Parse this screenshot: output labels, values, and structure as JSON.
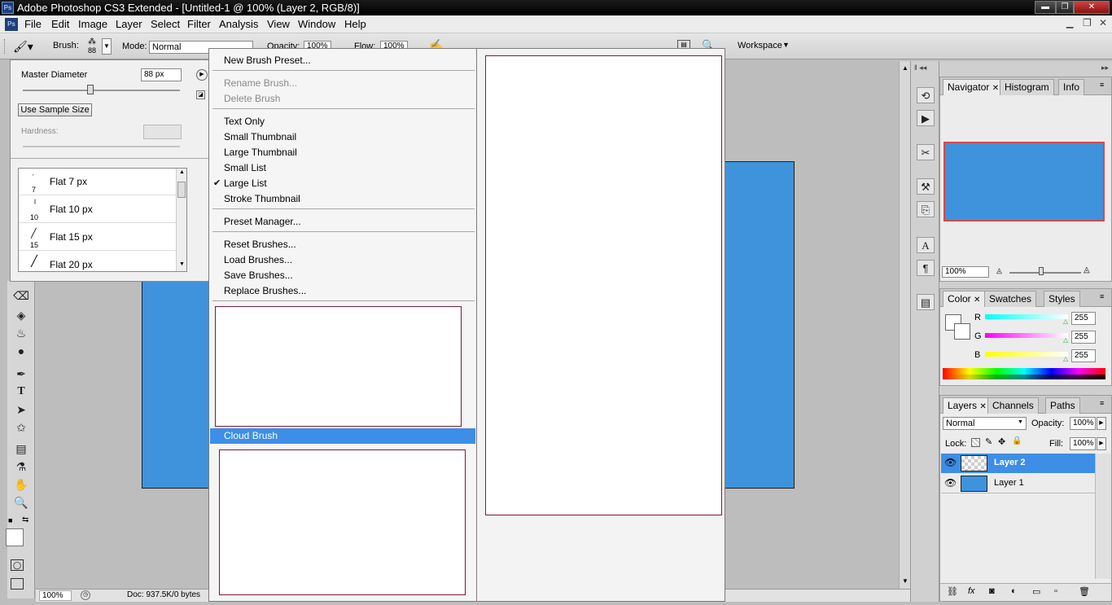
{
  "app": {
    "title": "Adobe Photoshop CS3 Extended - [Untitled-1 @ 100% (Layer 2, RGB/8)]",
    "logo": "Ps",
    "window_controls": [
      "minimize-icon",
      "restore-icon",
      "close-icon"
    ]
  },
  "menubar": [
    "File",
    "Edit",
    "Image",
    "Layer",
    "Select",
    "Filter",
    "Analysis",
    "View",
    "Window",
    "Help"
  ],
  "options": {
    "brush_label": "Brush:",
    "brush_size": "88",
    "mode_label": "Mode:",
    "mode_value": "Normal",
    "opacity_label": "Opacity:",
    "opacity_value": "100%",
    "flow_label": "Flow:",
    "flow_value": "100%",
    "workspace_label": "Workspace"
  },
  "brush_panel": {
    "master_label": "Master Diameter",
    "master_value": "88 px",
    "sample_button": "Use Sample Size",
    "hardness_label": "Hardness:",
    "presets": [
      {
        "size": "7",
        "name": "Flat 7 px"
      },
      {
        "size": "10",
        "name": "Flat 10 px"
      },
      {
        "size": "15",
        "name": "Flat 15 px"
      },
      {
        "size": "20",
        "name": "Flat 20 px"
      }
    ]
  },
  "brush_menu": {
    "new_preset": "New Brush Preset...",
    "rename": "Rename Brush...",
    "delete": "Delete Brush",
    "text_only": "Text Only",
    "small_thumb": "Small Thumbnail",
    "large_thumb": "Large Thumbnail",
    "small_list": "Small List",
    "large_list": "Large List",
    "stroke_thumb": "Stroke Thumbnail",
    "preset_manager": "Preset Manager...",
    "reset": "Reset Brushes...",
    "load": "Load Brushes...",
    "save": "Save Brushes...",
    "replace": "Replace Brushes...",
    "highlighted": "Cloud Brush",
    "check_mark": "✔"
  },
  "status": {
    "zoom": "100%",
    "doc": "Doc: 937.5K/0 bytes"
  },
  "navigator": {
    "tabs": [
      "Navigator",
      "Histogram",
      "Info"
    ],
    "zoom": "100%"
  },
  "color_panel": {
    "tabs": [
      "Color",
      "Swatches",
      "Styles"
    ],
    "channels": [
      {
        "label": "R",
        "value": "255"
      },
      {
        "label": "G",
        "value": "255"
      },
      {
        "label": "B",
        "value": "255"
      }
    ]
  },
  "layers_panel": {
    "tabs": [
      "Layers",
      "Channels",
      "Paths"
    ],
    "blend_mode": "Normal",
    "opacity_label": "Opacity:",
    "opacity_value": "100%",
    "lock_label": "Lock:",
    "fill_label": "Fill:",
    "fill_value": "100%",
    "layers": [
      {
        "name": "Layer 2",
        "selected": true
      },
      {
        "name": "Layer 1",
        "selected": false
      }
    ]
  },
  "colors": {
    "canvas_blue": "#3f93dc",
    "highlight": "#3d8ee6",
    "thumb_border": "#7a1a3a"
  }
}
